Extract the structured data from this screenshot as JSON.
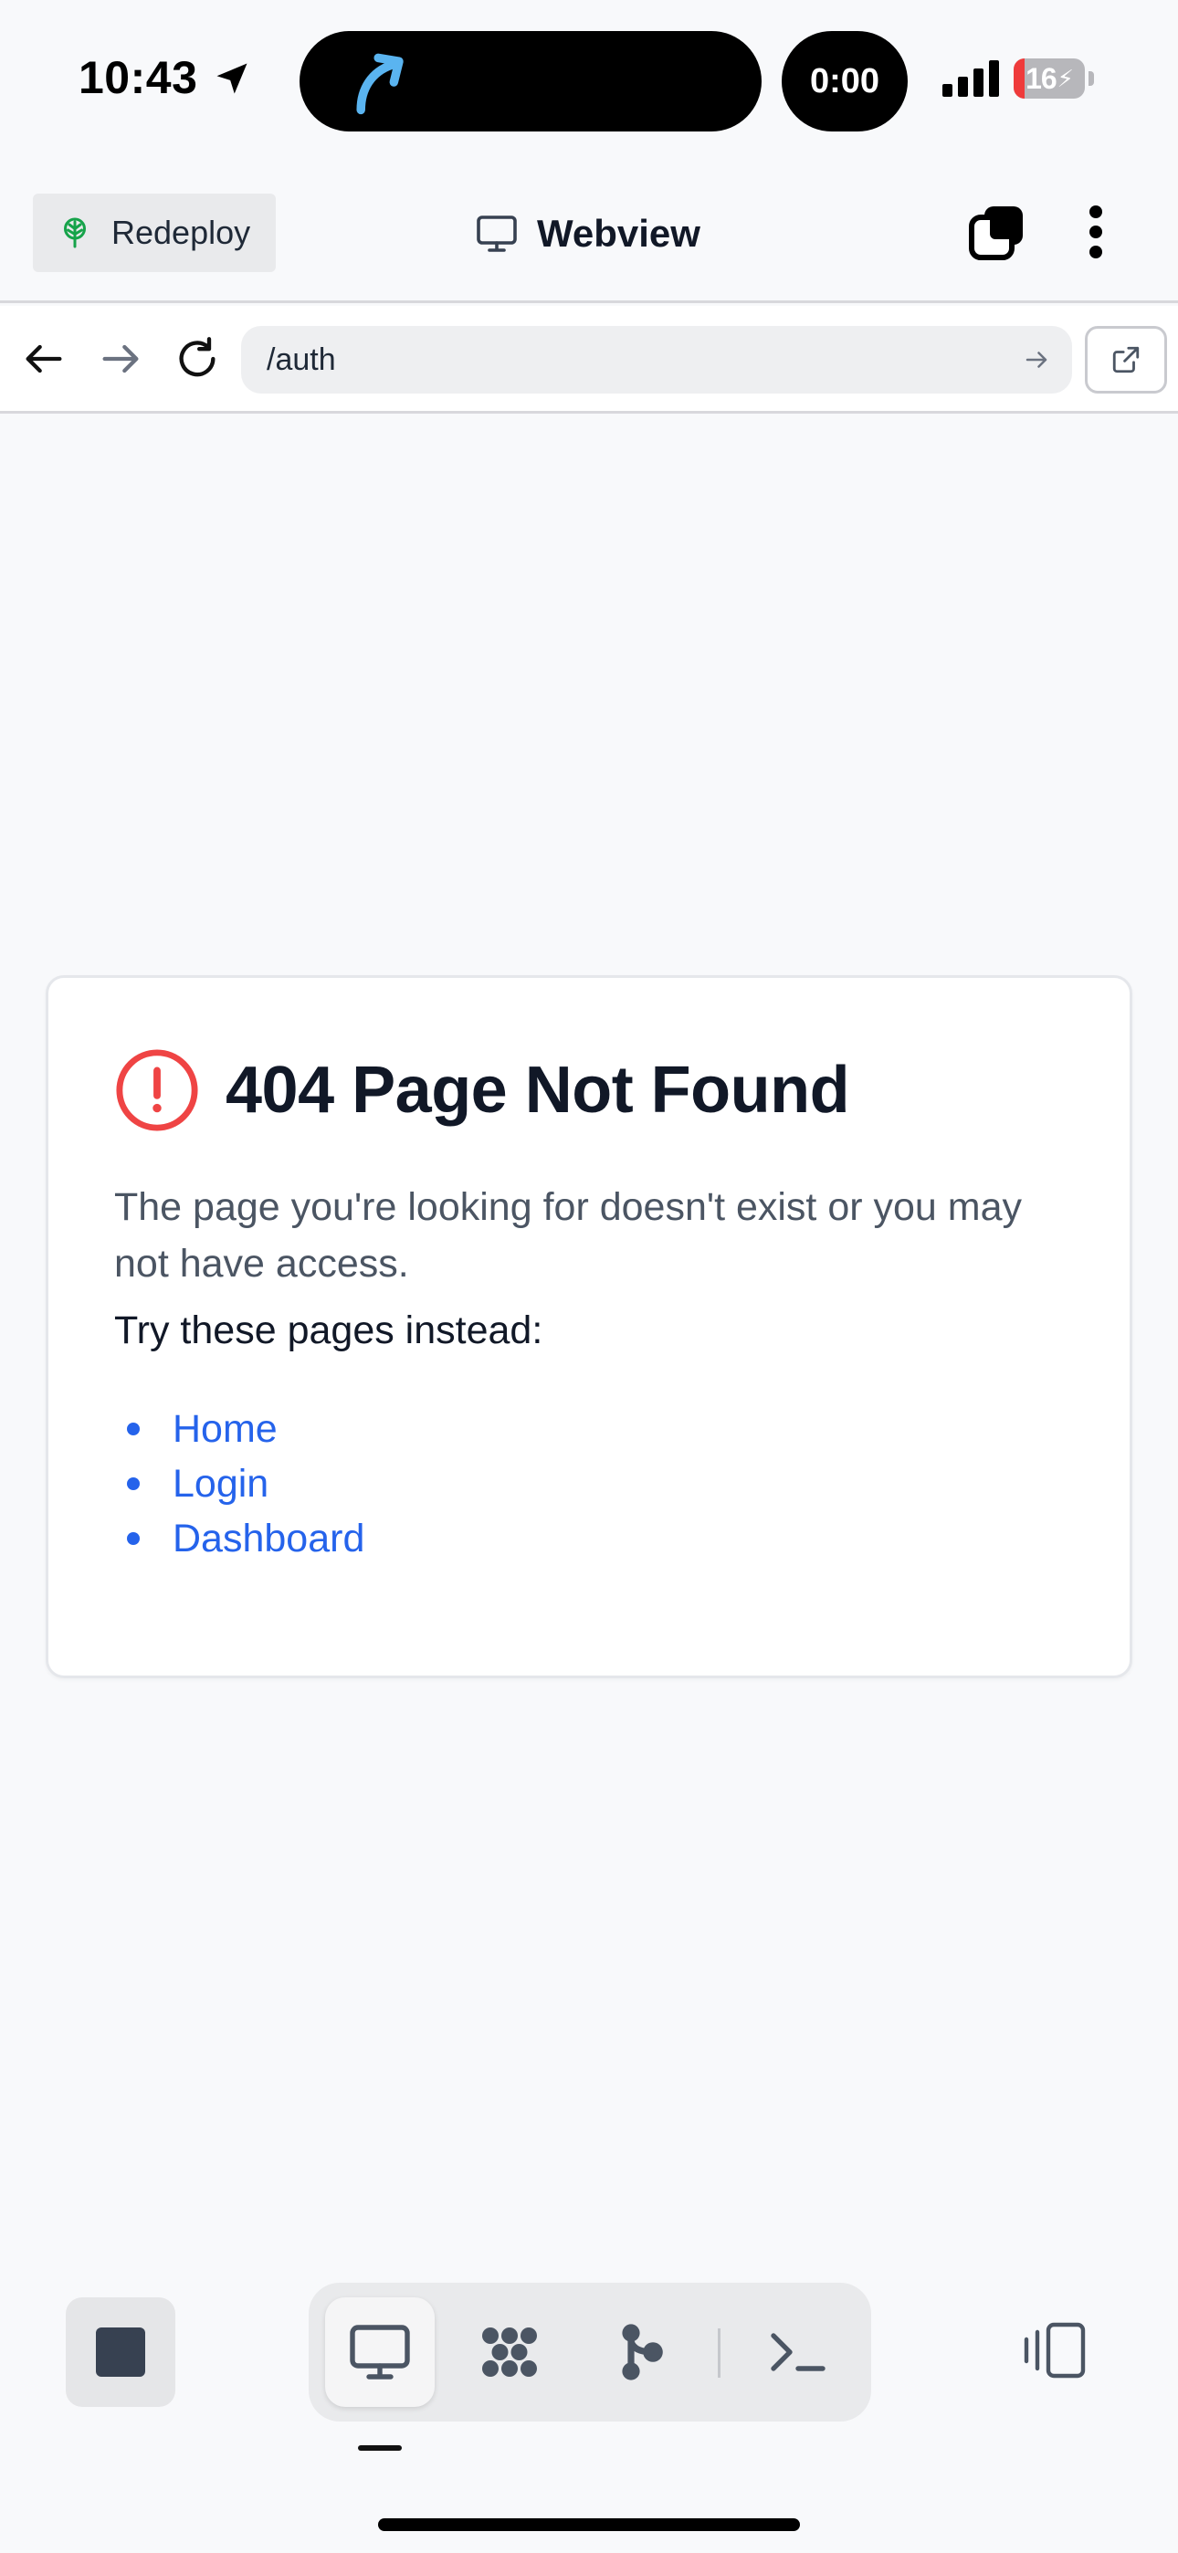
{
  "status_bar": {
    "time": "10:43",
    "timer": "0:00",
    "battery_level": "16",
    "battery_percent": 16
  },
  "header": {
    "redeploy_label": "Redeploy",
    "title": "Webview"
  },
  "url_bar": {
    "url": "/auth"
  },
  "error_card": {
    "title": "404 Page Not Found",
    "description": "The page you're looking for doesn't exist or you may not have access.",
    "suggestions_heading": "Try these pages instead:",
    "links": [
      "Home",
      "Login",
      "Dashboard"
    ]
  },
  "colors": {
    "accent_link": "#2563eb",
    "error_red": "#ef4444",
    "redeploy_icon": "#16a34a"
  },
  "icons": {
    "status": [
      "location-arrow-icon",
      "call-arrow-icon",
      "signal-icon",
      "battery-icon"
    ],
    "header": [
      "tree-icon",
      "monitor-icon",
      "tabs-icon",
      "more-vertical-icon"
    ],
    "nav": [
      "back-arrow-icon",
      "forward-arrow-icon",
      "reload-icon",
      "go-arrow-icon",
      "external-link-icon"
    ],
    "toolbar": [
      "stop-icon",
      "monitor-icon",
      "cluster-icon",
      "branch-icon",
      "terminal-icon",
      "panel-toggle-icon"
    ]
  }
}
